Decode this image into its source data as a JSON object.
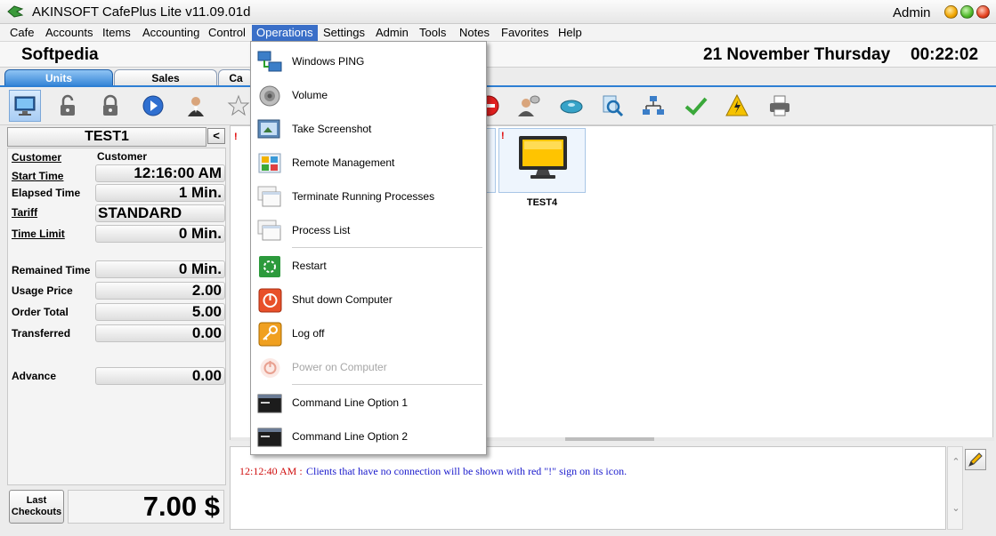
{
  "window": {
    "title": "AKINSOFT CafePlus Lite v11.09.01d",
    "user": "Admin"
  },
  "menu": [
    "Cafe",
    "Accounts",
    "Items",
    "Accounting",
    "Control",
    "Operations",
    "Settings",
    "Admin",
    "Tools",
    "Notes",
    "Favorites",
    "Help"
  ],
  "menu_active": "Operations",
  "header": {
    "cafe_name": "Softpedia",
    "date": "21 November Thursday",
    "time": "00:22:02"
  },
  "tabs": [
    "Units",
    "Sales",
    "Ca"
  ],
  "toolbar_icons": [
    "monitor-icon",
    "unlock-icon",
    "lock-icon",
    "play-icon",
    "person-icon",
    "star-icon",
    "stop-icon",
    "user-chat-icon",
    "disk-icon",
    "search-icon",
    "network-icon",
    "checkmark-icon",
    "lightning-icon",
    "printer-icon"
  ],
  "left_panel": {
    "unit_name": "TEST1",
    "collapse_label": "<",
    "fields": {
      "customer_label": "Customer",
      "customer_value": "Customer",
      "start_time_label": "Start Time",
      "start_time_value": "12:16:00 AM",
      "elapsed_label": "Elapsed Time",
      "elapsed_value": "1 Min.",
      "tariff_label": "Tariff",
      "tariff_value": "STANDARD",
      "time_limit_label": "Time Limit",
      "time_limit_value": "0 Min.",
      "remained_label": "Remained Time",
      "remained_value": "0 Min.",
      "usage_label": "Usage Price",
      "usage_value": "2.00",
      "order_label": "Order Total",
      "order_value": "5.00",
      "transferred_label": "Transferred",
      "transferred_value": "0.00",
      "advance_label": "Advance",
      "advance_value": "0.00"
    },
    "last_checkouts_line1": "Last",
    "last_checkouts_line2": "Checkouts",
    "total": "7.00 $"
  },
  "units": [
    {
      "name": "TEST4",
      "alert": "!"
    }
  ],
  "alert_marker": "!",
  "log": {
    "time": "12:12:40 AM :",
    "message": "Clients that have no connection will be shown with red \"!\" sign on its icon."
  },
  "operations_menu": [
    {
      "label": "Windows PING",
      "icon": "network-ping-icon",
      "enabled": true
    },
    {
      "label": "Volume",
      "icon": "speaker-icon",
      "enabled": true
    },
    {
      "label": "Take Screenshot",
      "icon": "screenshot-icon",
      "enabled": true
    },
    {
      "label": "Remote Management",
      "icon": "remote-management-icon",
      "enabled": true
    },
    {
      "label": "Terminate Running Processes",
      "icon": "windows-stack-icon",
      "enabled": true
    },
    {
      "label": "Process List",
      "icon": "windows-stack-icon",
      "enabled": true
    },
    {
      "label": "Restart",
      "icon": "restart-icon",
      "enabled": true
    },
    {
      "label": "Shut down Computer",
      "icon": "power-icon",
      "enabled": true
    },
    {
      "label": "Log off",
      "icon": "key-icon",
      "enabled": true
    },
    {
      "label": "Power on Computer",
      "icon": "power-on-icon",
      "enabled": false
    },
    {
      "label": "Command Line Option 1",
      "icon": "terminal-icon",
      "enabled": true
    },
    {
      "label": "Command Line Option 2",
      "icon": "terminal-icon",
      "enabled": true
    }
  ]
}
